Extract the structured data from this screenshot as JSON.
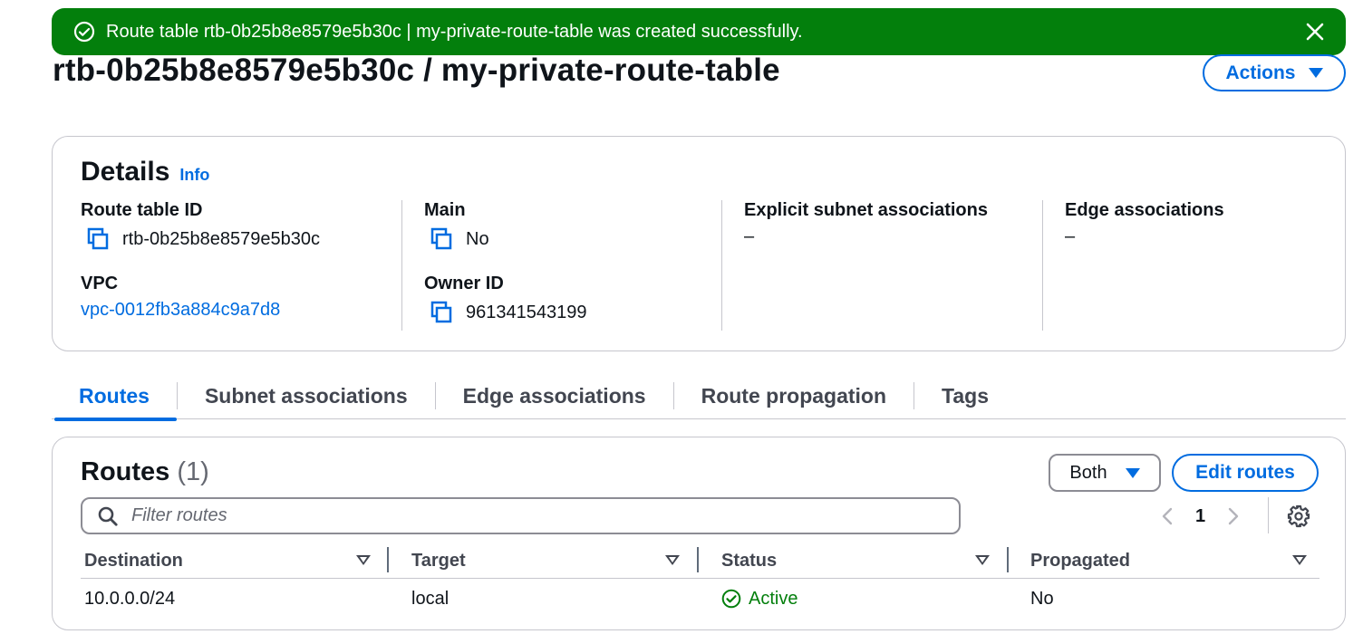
{
  "flash": {
    "message": "Route table rtb-0b25b8e8579e5b30c | my-private-route-table was created successfully.",
    "icon": "success-check-icon",
    "color": "#037f0c"
  },
  "page": {
    "title": "rtb-0b25b8e8579e5b30c / my-private-route-table",
    "actions_label": "Actions"
  },
  "details": {
    "heading": "Details",
    "info_label": "Info",
    "route_table_id_label": "Route table ID",
    "route_table_id_value": "rtb-0b25b8e8579e5b30c",
    "vpc_label": "VPC",
    "vpc_value": "vpc-0012fb3a884c9a7d8",
    "main_label": "Main",
    "main_value": "No",
    "owner_id_label": "Owner ID",
    "owner_id_value": "961341543199",
    "explicit_subnet_label": "Explicit subnet associations",
    "explicit_subnet_value": "–",
    "edge_assoc_label": "Edge associations",
    "edge_assoc_value": "–"
  },
  "tabs": [
    {
      "label": "Routes",
      "active": true
    },
    {
      "label": "Subnet associations",
      "active": false
    },
    {
      "label": "Edge associations",
      "active": false
    },
    {
      "label": "Route propagation",
      "active": false
    },
    {
      "label": "Tags",
      "active": false
    }
  ],
  "routes": {
    "heading": "Routes",
    "count": "(1)",
    "both_label": "Both",
    "edit_label": "Edit routes",
    "filter_placeholder": "Filter routes",
    "page_number": "1",
    "columns": [
      "Destination",
      "Target",
      "Status",
      "Propagated"
    ],
    "rows": [
      {
        "destination": "10.0.0.0/24",
        "target": "local",
        "status": "Active",
        "propagated": "No"
      }
    ]
  },
  "colors": {
    "accent": "#006ce0",
    "success": "#037f0c"
  }
}
